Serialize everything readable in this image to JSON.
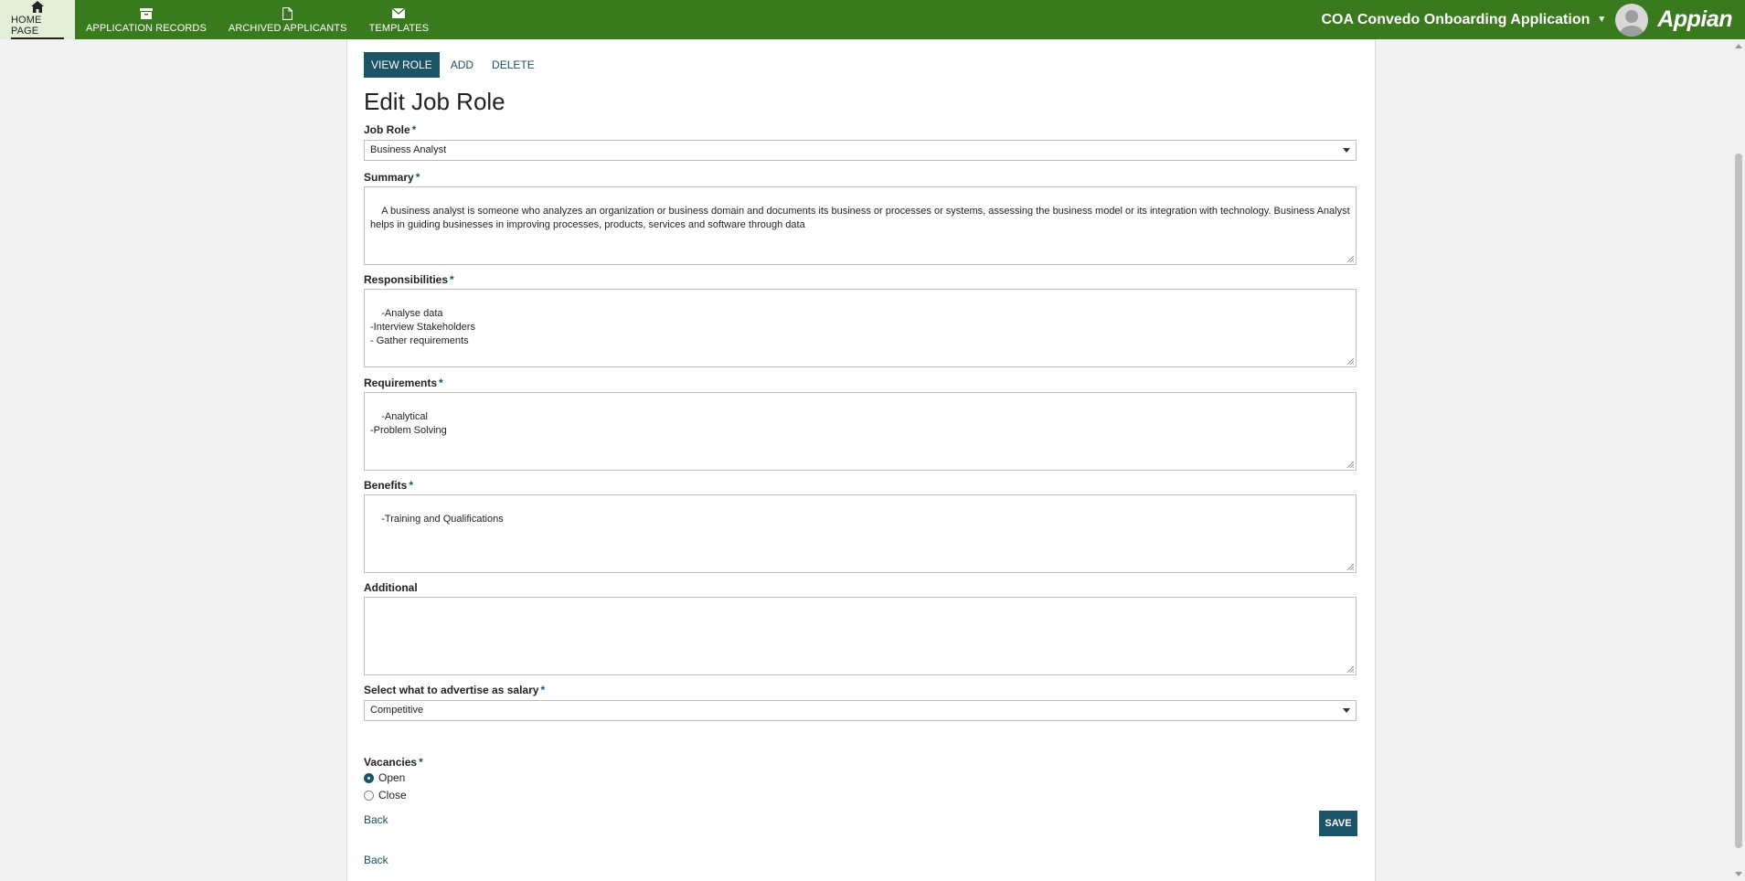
{
  "nav": {
    "items": [
      {
        "label": "HOME PAGE",
        "icon": "home-icon"
      },
      {
        "label": "APPLICATION RECORDS",
        "icon": "archive-box-icon"
      },
      {
        "label": "ARCHIVED APPLICANTS",
        "icon": "document-icon"
      },
      {
        "label": "TEMPLATES",
        "icon": "envelope-icon"
      }
    ],
    "app_name": "COA Convedo Onboarding Application",
    "logo": "Appian",
    "color": "#3a7a1e"
  },
  "tabs": [
    "VIEW ROLE",
    "ADD",
    "DELETE"
  ],
  "form": {
    "title": "Edit Job Role",
    "job_role": {
      "label": "Job Role",
      "value": "Business Analyst"
    },
    "summary": {
      "label": "Summary",
      "value": "A business analyst is someone who analyzes an organization or business domain and documents its business or processes or systems, assessing the business model or its integration with technology. Business Analyst helps in guiding businesses in improving processes, products, services and software through data"
    },
    "responsibilities": {
      "label": "Responsibilities",
      "value": "-Analyse data\n-Interview Stakeholders\n- Gather requirements"
    },
    "requirements": {
      "label": "Requirements",
      "value": "-Analytical\n-Problem Solving"
    },
    "benefits": {
      "label": "Benefits",
      "value": "-Training and Qualifications"
    },
    "additional": {
      "label": "Additional",
      "value": ""
    },
    "salary": {
      "label": "Select what to advertise as salary",
      "value": "Competitive"
    },
    "vacancies": {
      "label": "Vacancies",
      "options": [
        "Open",
        "Close"
      ],
      "selected": "Open"
    },
    "required_mark": "*",
    "back_label": "Back",
    "save_label": "SAVE",
    "bottom_back_label": "Back"
  },
  "accent": "#1b5466"
}
